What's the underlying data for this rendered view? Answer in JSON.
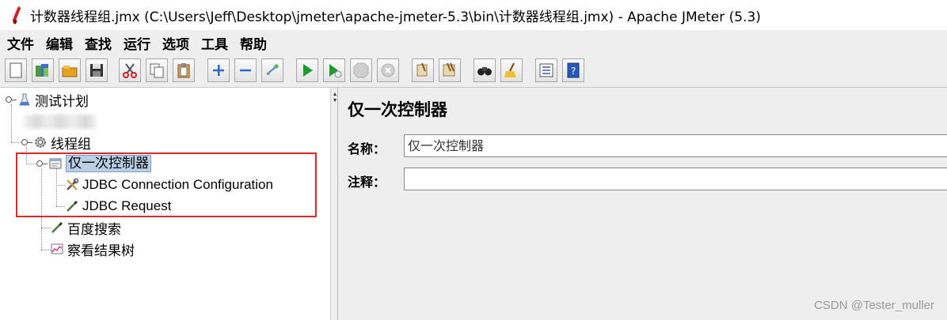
{
  "window": {
    "title": "计数器线程组.jmx (C:\\Users\\Jeff\\Desktop\\jmeter\\apache-jmeter-5.3\\bin\\计数器线程组.jmx) - Apache JMeter (5.3)"
  },
  "menubar": {
    "items": [
      "文件",
      "编辑",
      "查找",
      "运行",
      "选项",
      "工具",
      "帮助"
    ]
  },
  "toolbar": {
    "buttons": [
      "new-icon",
      "templates-icon",
      "open-icon",
      "save-icon",
      "cut-icon",
      "copy-icon",
      "paste-icon",
      "expand-icon",
      "collapse-icon",
      "toggle-icon",
      "start-icon",
      "start-no-pause-icon",
      "stop-icon",
      "shutdown-icon",
      "clear-icon",
      "clear-all-icon",
      "search-icon",
      "reset-search-icon",
      "function-helper-icon",
      "help-icon"
    ]
  },
  "tree": {
    "nodes": [
      {
        "label": "测试计划",
        "icon": "test-plan-icon"
      },
      {
        "label": "线程组",
        "icon": "gear-icon"
      },
      {
        "label": "仅一次控制器",
        "icon": "controller-icon",
        "selected": true
      },
      {
        "label": "JDBC Connection Configuration",
        "icon": "tools-icon"
      },
      {
        "label": "JDBC Request",
        "icon": "pipette-icon"
      },
      {
        "label": "百度搜索",
        "icon": "pipette-icon"
      },
      {
        "label": "察看结果树",
        "icon": "chart-icon"
      }
    ]
  },
  "editor": {
    "title": "仅一次控制器",
    "name_label": "名称：",
    "name_value": "仅一次控制器",
    "comment_label": "注释：",
    "comment_value": ""
  },
  "watermark": "CSDN @Tester_muller",
  "colors": {
    "selection": "#b8cfe5",
    "highlight_box": "#e02828",
    "panel_bg": "#eeeeee"
  }
}
